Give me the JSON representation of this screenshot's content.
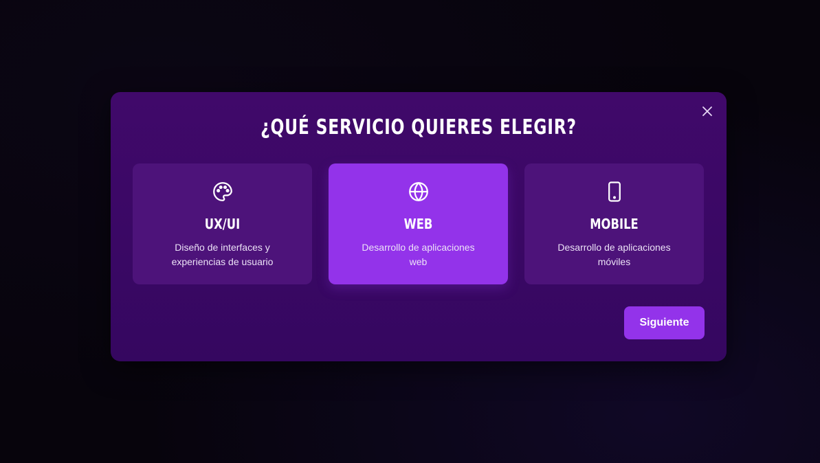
{
  "modal": {
    "title": "¿QUÉ SERVICIO QUIERES ELEGIR?",
    "close_icon": "close-icon",
    "next_label": "Siguiente"
  },
  "services": [
    {
      "icon": "palette-icon",
      "title": "UX/UI",
      "description": "Diseño de interfaces y experiencias de usuario",
      "selected": false
    },
    {
      "icon": "globe-icon",
      "title": "WEB",
      "description": "Desarrollo de aplicaciones web",
      "selected": true
    },
    {
      "icon": "tablet-icon",
      "title": "MOBILE",
      "description": "Desarrollo de aplicaciones móviles",
      "selected": false
    }
  ],
  "colors": {
    "modal_background": "#3c0866",
    "card_background": "#4d137a",
    "accent": "#9333ea",
    "text": "#ffffff"
  }
}
